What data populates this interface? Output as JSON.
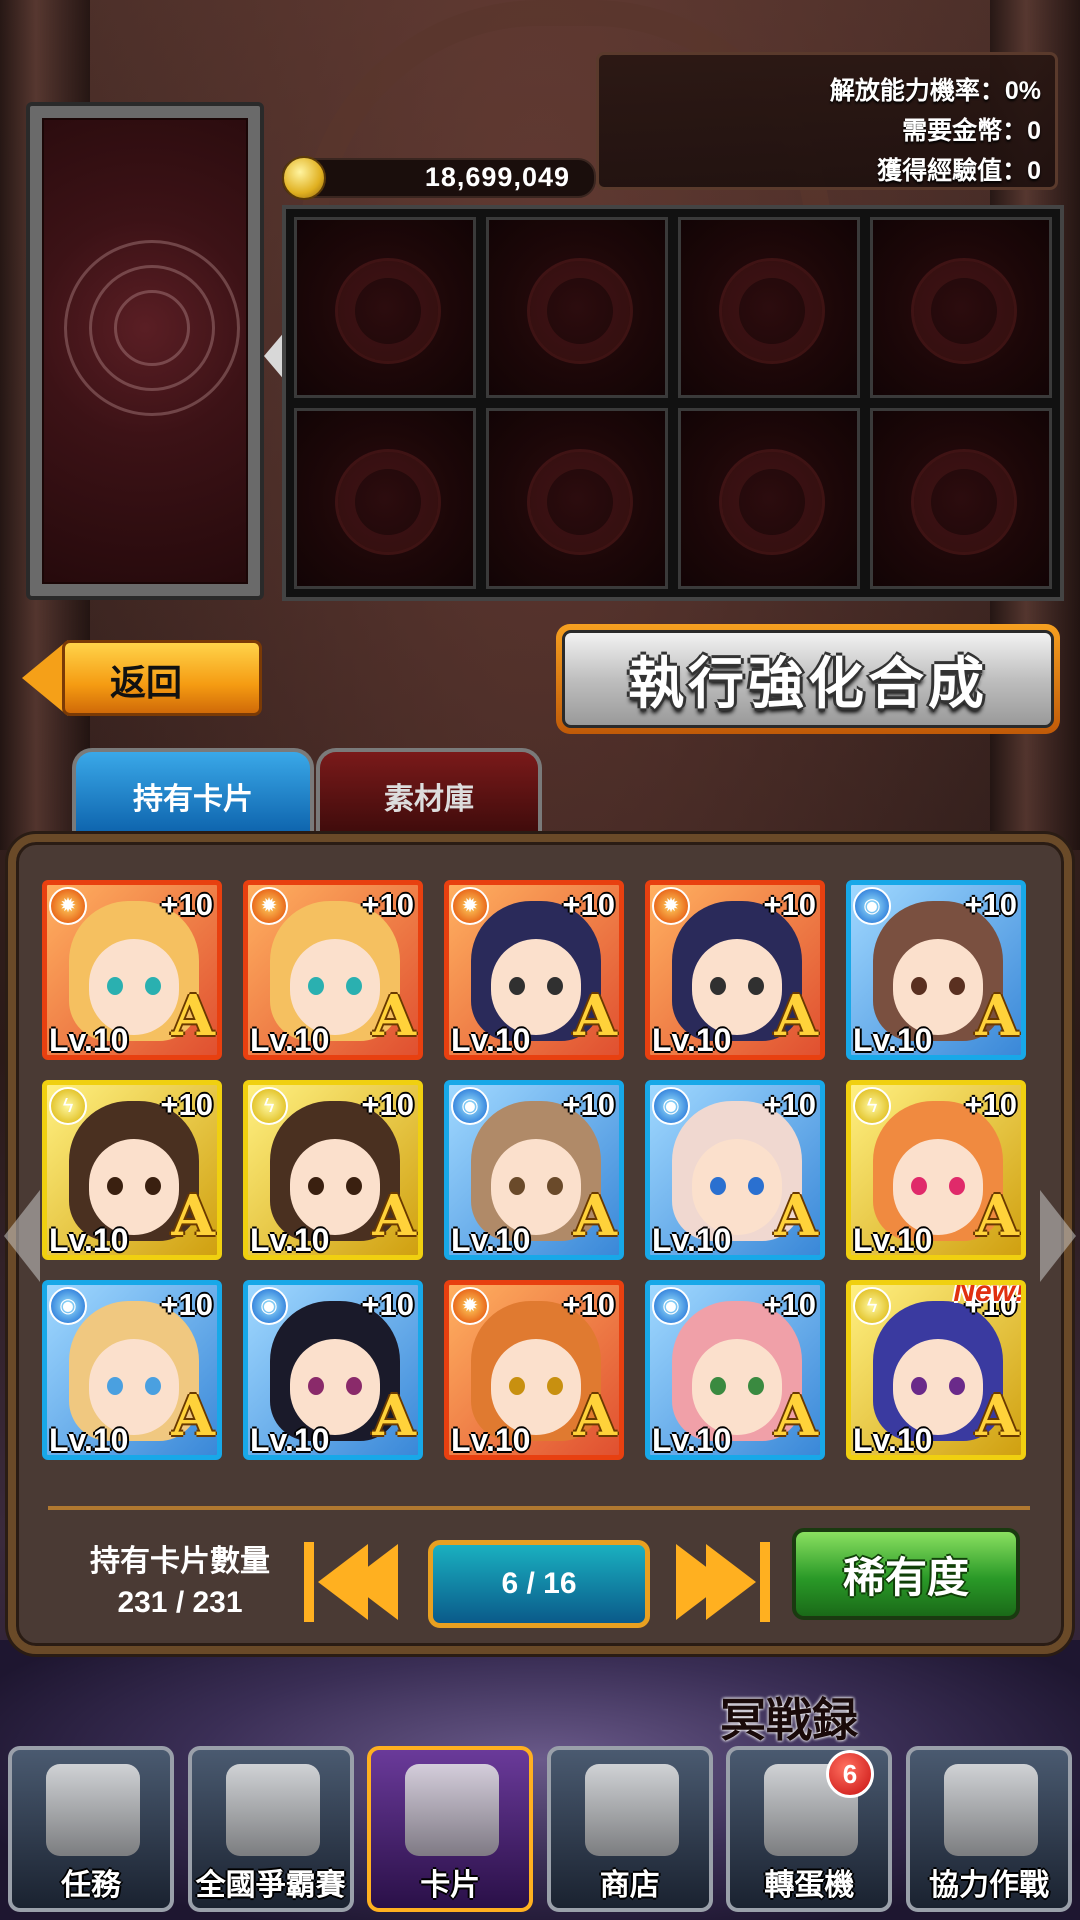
{
  "info": {
    "release_rate": "解放能力機率：0%",
    "required_gold": "需要金幣：0",
    "gained_exp": "獲得經驗值：0"
  },
  "gold": "18,699,049",
  "buttons": {
    "back": "返回",
    "execute": "執行強化合成",
    "rarity": "稀有度"
  },
  "tabs": [
    "持有卡片",
    "素材庫"
  ],
  "cards": [
    {
      "element": "fire",
      "plus": "+10",
      "rank": "A",
      "level": "Lv.10",
      "hair": "#f5c060",
      "eye": "#2ab0b0",
      "new": ""
    },
    {
      "element": "fire",
      "plus": "+10",
      "rank": "A",
      "level": "Lv.10",
      "hair": "#f5c060",
      "eye": "#2ab0b0",
      "new": ""
    },
    {
      "element": "fire",
      "plus": "+10",
      "rank": "A",
      "level": "Lv.10",
      "hair": "#2a2a5a",
      "eye": "#303030",
      "new": ""
    },
    {
      "element": "fire",
      "plus": "+10",
      "rank": "A",
      "level": "Lv.10",
      "hair": "#2a2a5a",
      "eye": "#303030",
      "new": ""
    },
    {
      "element": "water",
      "plus": "+10",
      "rank": "A",
      "level": "Lv.10",
      "hair": "#7a5040",
      "eye": "#5a3020",
      "new": ""
    },
    {
      "element": "thunder",
      "plus": "+10",
      "rank": "A",
      "level": "Lv.10",
      "hair": "#4a3020",
      "eye": "#3a2010",
      "new": ""
    },
    {
      "element": "thunder",
      "plus": "+10",
      "rank": "A",
      "level": "Lv.10",
      "hair": "#4a3020",
      "eye": "#3a2010",
      "new": ""
    },
    {
      "element": "water",
      "plus": "+10",
      "rank": "A",
      "level": "Lv.10",
      "hair": "#b08a68",
      "eye": "#6a4a2a",
      "new": ""
    },
    {
      "element": "water",
      "plus": "+10",
      "rank": "A",
      "level": "Lv.10",
      "hair": "#f0d8d0",
      "eye": "#2a70d0",
      "new": ""
    },
    {
      "element": "thunder",
      "plus": "+10",
      "rank": "A",
      "level": "Lv.10",
      "hair": "#f08a40",
      "eye": "#e02a6a",
      "new": ""
    },
    {
      "element": "water",
      "plus": "+10",
      "rank": "A",
      "level": "Lv.10",
      "hair": "#f0c880",
      "eye": "#4aa0e0",
      "new": ""
    },
    {
      "element": "water",
      "plus": "+10",
      "rank": "A",
      "level": "Lv.10",
      "hair": "#1a1a2a",
      "eye": "#8a2a6a",
      "new": ""
    },
    {
      "element": "fire",
      "plus": "+10",
      "rank": "A",
      "level": "Lv.10",
      "hair": "#e07a30",
      "eye": "#c89010",
      "new": ""
    },
    {
      "element": "water",
      "plus": "+10",
      "rank": "A",
      "level": "Lv.10",
      "hair": "#f0a0a8",
      "eye": "#3a8a40",
      "new": ""
    },
    {
      "element": "thunder",
      "plus": "+10",
      "rank": "A",
      "level": "Lv.10",
      "hair": "#3a3aa0",
      "eye": "#6a2a8a",
      "new": "New!"
    }
  ],
  "owned": {
    "label": "持有卡片數量",
    "value": "231 / 231"
  },
  "page": "6 / 16",
  "logo": "冥戦録",
  "nav": [
    {
      "label": "任務",
      "icon": "document-icon",
      "active": false
    },
    {
      "label": "全國爭霸賽",
      "icon": "trophy-icon",
      "active": false
    },
    {
      "label": "卡片",
      "icon": "cards-icon",
      "active": true
    },
    {
      "label": "商店",
      "icon": "gems-icon",
      "active": false
    },
    {
      "label": "轉蛋機",
      "icon": "gacha-icon",
      "active": false
    },
    {
      "label": "協力作戰",
      "icon": "castle-icon",
      "active": false
    }
  ],
  "gacha_badge": "6"
}
